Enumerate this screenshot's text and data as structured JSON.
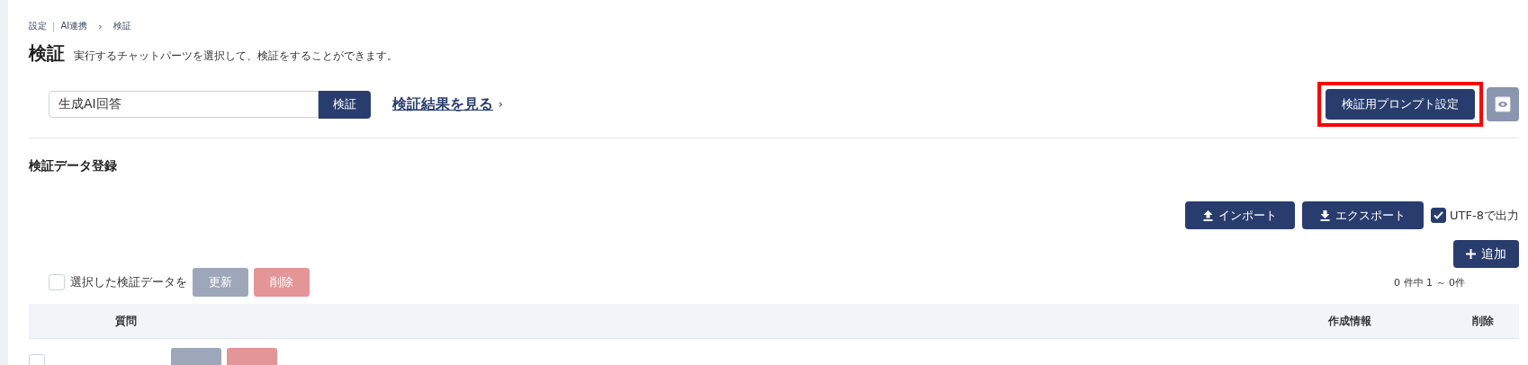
{
  "breadcrumb": [
    {
      "label": "設定"
    },
    {
      "separator": "|",
      "label": "AI連携"
    },
    {
      "separator": "›",
      "label": "検証"
    }
  ],
  "page": {
    "title": "検証",
    "description": "実行するチャットパーツを選択して、検証をすることができます。"
  },
  "verify": {
    "value": "生成AI回答",
    "button": "検証",
    "link": "検証結果を見る",
    "link_arrow": "›"
  },
  "prompt_button": {
    "label": "検証用プロンプト設定",
    "highlighted": true
  },
  "section": {
    "title": "検証データ登録"
  },
  "import_button": "インポート",
  "export_button": "エクスポート",
  "utf8": {
    "label": "UTF-8で出力",
    "checked": true
  },
  "add_button": "追加",
  "bulk_bars": [
    {
      "checked": false,
      "label": "選択した検証データを",
      "update": "更新",
      "delete": "削除",
      "disabled": true,
      "count": "0 件中 1 ～ 0件"
    },
    {
      "checked": false,
      "disabled": true
    }
  ],
  "table": {
    "columns": [
      {
        "label": "質問"
      },
      {
        "label": "作成情報"
      },
      {
        "label": "削除"
      }
    ]
  }
}
